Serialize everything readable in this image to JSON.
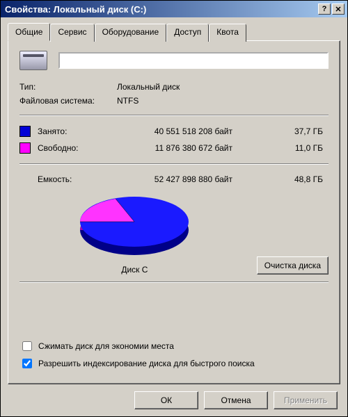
{
  "window": {
    "title": "Свойства: Локальный диск (C:)"
  },
  "tabs": [
    {
      "label": "Общие",
      "active": true
    },
    {
      "label": "Сервис"
    },
    {
      "label": "Оборудование"
    },
    {
      "label": "Доступ"
    },
    {
      "label": "Квота"
    }
  ],
  "drive": {
    "label_value": "",
    "type_label": "Тип:",
    "type_value": "Локальный диск",
    "fs_label": "Файловая система:",
    "fs_value": "NTFS"
  },
  "usage": {
    "used_label": "Занято:",
    "used_bytes": "40 551 518 208 байт",
    "used_gb": "37,7 ГБ",
    "free_label": "Свободно:",
    "free_bytes": "11 876 380 672 байт",
    "free_gb": "11,0 ГБ",
    "cap_label": "Емкость:",
    "cap_bytes": "52 427 898 880 байт",
    "cap_gb": "48,8 ГБ"
  },
  "pie_caption": "Диск C",
  "cleanup_button": "Очистка диска",
  "checks": {
    "compress": "Сжимать диск для экономии места",
    "compress_checked": false,
    "index": "Разрешить индексирование диска для быстрого поиска",
    "index_checked": true
  },
  "footer": {
    "ok": "ОК",
    "cancel": "Отмена",
    "apply": "Применить"
  },
  "colors": {
    "used": "#0000d6",
    "free": "#ff00ff"
  },
  "chart_data": {
    "type": "pie",
    "title": "Диск C",
    "series": [
      {
        "name": "Занято",
        "value": 40551518208,
        "fraction": 0.773,
        "color": "#0000d6"
      },
      {
        "name": "Свободно",
        "value": 11876380672,
        "fraction": 0.227,
        "color": "#ff00ff"
      }
    ],
    "total": 52427898880
  }
}
